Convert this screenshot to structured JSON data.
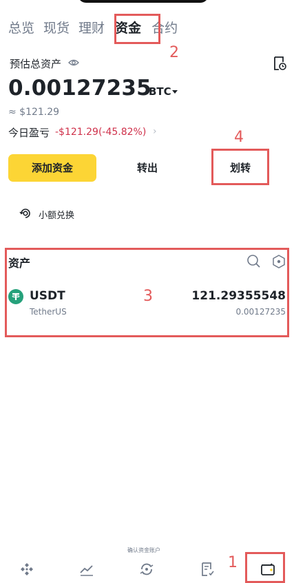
{
  "tabs": [
    {
      "label": "总览",
      "active": false
    },
    {
      "label": "现货",
      "active": false
    },
    {
      "label": "理财",
      "active": false
    },
    {
      "label": "资金",
      "active": true
    },
    {
      "label": "合约",
      "active": false
    }
  ],
  "balance": {
    "label": "预估总资产",
    "value": "0.00127235",
    "unit": "BTC",
    "fiat": "≈ $121.29"
  },
  "pnl": {
    "label": "今日盈亏",
    "value": "-$121.29(-45.82%)"
  },
  "actions": {
    "add": "添加资金",
    "withdraw": "转出",
    "transfer": "划转"
  },
  "small_swap": "小额兑换",
  "assets": {
    "title": "资产",
    "items": [
      {
        "symbol": "USDT",
        "name": "TetherUS",
        "amount": "121.29355548",
        "btc_value": "0.00127235"
      }
    ]
  },
  "annotations": {
    "n1": "1",
    "n2": "2",
    "n3": "3",
    "n4": "4"
  },
  "bottom_overlay_text": "确认资金账户",
  "colors": {
    "accent": "#fcd535",
    "loss": "#cf304a",
    "annotation": "#e35a5a",
    "usdt": "#26a17b"
  }
}
